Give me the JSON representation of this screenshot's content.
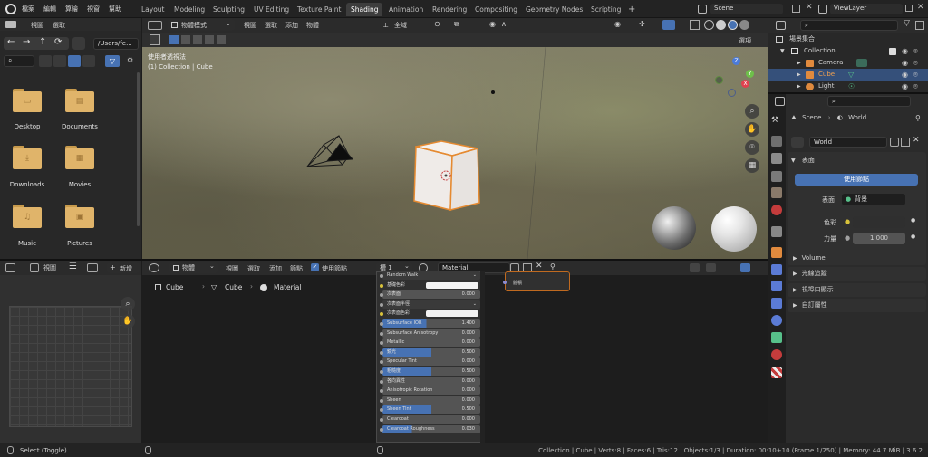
{
  "topbar": {
    "menus": [
      "檔案",
      "編輯",
      "算繪",
      "視窗",
      "幫助"
    ],
    "workspaces": [
      "Layout",
      "Modeling",
      "Sculpting",
      "UV Editing",
      "Texture Paint",
      "Shading",
      "Animation",
      "Rendering",
      "Compositing",
      "Geometry Nodes",
      "Scripting"
    ],
    "active_workspace": "Shading",
    "add_tab": "+",
    "scene_name": "Scene",
    "view_layer": "ViewLayer"
  },
  "file_browser": {
    "menu": [
      "視圖",
      "選取"
    ],
    "path": "/Users/fe...",
    "items": [
      {
        "label": "Desktop",
        "glyph": "▭"
      },
      {
        "label": "Documents",
        "glyph": "▤"
      },
      {
        "label": "Downloads",
        "glyph": "⤓"
      },
      {
        "label": "Movies",
        "glyph": "▦"
      },
      {
        "label": "Music",
        "glyph": "♫"
      },
      {
        "label": "Pictures",
        "glyph": "▣"
      }
    ]
  },
  "viewport": {
    "mode": "物體模式",
    "menus": [
      "視圖",
      "選取",
      "添加",
      "物體"
    ],
    "transform": "全域",
    "options": "選項",
    "overlay_line1": "使用者透視法",
    "overlay_line2": "(1) Collection | Cube",
    "gizmo": {
      "x": "X",
      "y": "Y",
      "z": "Z"
    }
  },
  "image_editor": {
    "menu": "視圖",
    "new_label": "新增"
  },
  "node_editor": {
    "mode": "物體",
    "menus": [
      "視圖",
      "選取",
      "添加",
      "節點"
    ],
    "use_nodes": "使用節點",
    "slot": "槽 1",
    "material": "Material",
    "breadcrumb": [
      "Cube",
      "Cube",
      "Material"
    ],
    "principled_rows": [
      {
        "label": "Random Walk",
        "value": "",
        "kind": "dropdown"
      },
      {
        "label": "基礎色彩",
        "value": "",
        "kind": "color"
      },
      {
        "label": "次表面",
        "value": "0.000",
        "kind": "plain"
      },
      {
        "label": "次表面半徑",
        "value": "",
        "kind": "dropdown"
      },
      {
        "label": "次表面色彩",
        "value": "",
        "kind": "color"
      },
      {
        "label": "Subsurface IOR",
        "value": "1.400",
        "kind": "blue"
      },
      {
        "label": "Subsurface Anisotropy",
        "value": "0.000",
        "kind": "plain"
      },
      {
        "label": "Metallic",
        "value": "0.000",
        "kind": "plain"
      },
      {
        "label": "鏡光",
        "value": "0.500",
        "kind": "blue2"
      },
      {
        "label": "Specular Tint",
        "value": "0.000",
        "kind": "plain"
      },
      {
        "label": "粗糙度",
        "value": "0.500",
        "kind": "blue2"
      },
      {
        "label": "各向異性",
        "value": "0.000",
        "kind": "plain"
      },
      {
        "label": "Anisotropic Rotation",
        "value": "0.000",
        "kind": "plain"
      },
      {
        "label": "Sheen",
        "value": "0.000",
        "kind": "plain"
      },
      {
        "label": "Sheen Tint",
        "value": "0.500",
        "kind": "blue2"
      },
      {
        "label": "Clearcoat",
        "value": "0.000",
        "kind": "plain"
      },
      {
        "label": "Clearcoat Roughness",
        "value": "0.030",
        "kind": "blue3"
      }
    ],
    "output_node_label": "體積"
  },
  "outliner": {
    "scene_collection": "場景集合",
    "collection": "Collection",
    "items": [
      {
        "label": "Camera",
        "color": "#e08a3e"
      },
      {
        "label": "Cube",
        "color": "#e08a3e"
      },
      {
        "label": "Light",
        "color": "#e08a3e"
      }
    ],
    "selected": "Cube"
  },
  "properties": {
    "breadcrumb": [
      "Scene",
      "World"
    ],
    "world_name": "World",
    "surface_section": "表面",
    "use_nodes_button": "使用節點",
    "surface_label": "表面",
    "surface_value": "背景",
    "color_label": "色彩",
    "strength_label": "力量",
    "strength_value": "1.000",
    "sections": [
      "Volume",
      "光線追蹤",
      "視埠口顯示",
      "自訂屬性"
    ]
  },
  "statusbar": {
    "left": "Select (Toggle)",
    "right": "Collection | Cube | Verts:8 | Faces:6 | Tris:12 | Objects:1/3 | Duration: 00:10+10 (Frame 1/250) | Memory: 44.7 MiB | 3.6.2"
  },
  "colors": {
    "accent": "#4772b3",
    "selection_orange": "#e08a3e",
    "folder": "#e0b46a"
  }
}
